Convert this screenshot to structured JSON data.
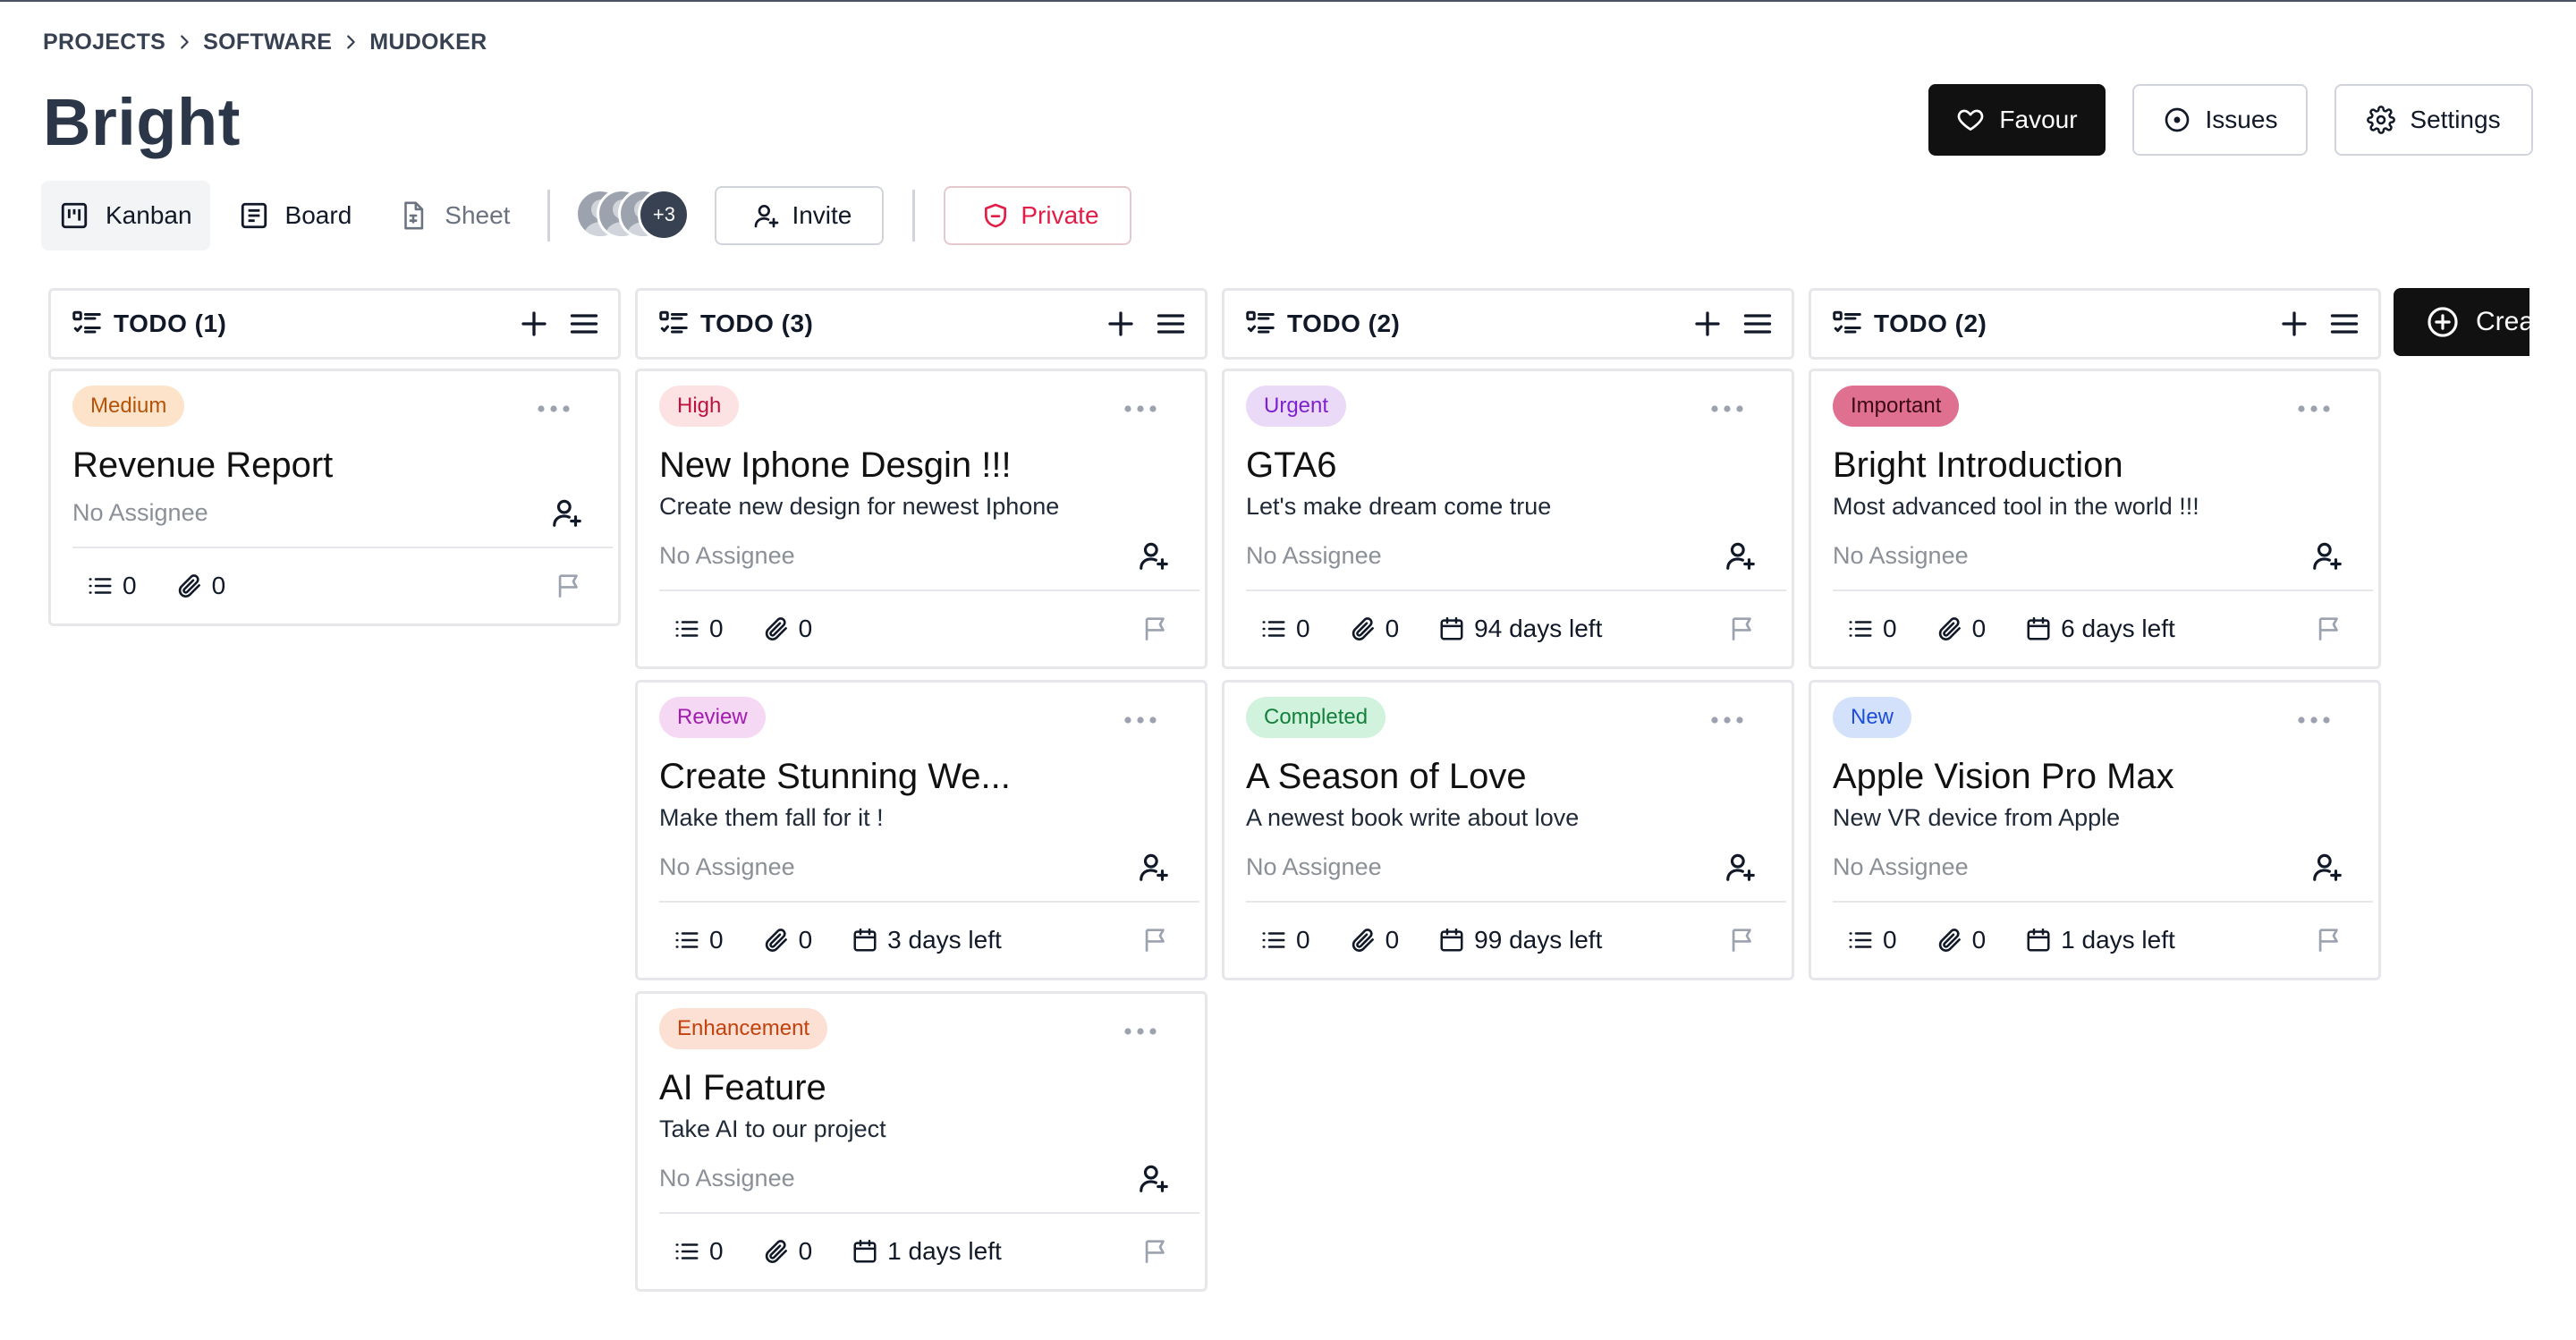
{
  "breadcrumb": [
    "PROJECTS",
    "SOFTWARE",
    "MUDOKER"
  ],
  "title": "Bright",
  "header_buttons": {
    "favour": "Favour",
    "issues": "Issues",
    "settings": "Settings"
  },
  "views": {
    "kanban": "Kanban",
    "board": "Board",
    "sheet": "Sheet"
  },
  "members": {
    "more_count": "+3"
  },
  "invite_label": "Invite",
  "private_label": "Private",
  "create_label": "Create",
  "columns": [
    {
      "title": "TODO (1)",
      "cards": [
        {
          "badge": "Medium",
          "badge_bg": "#fde3c9",
          "badge_fg": "#b45309",
          "title": "Revenue Report",
          "desc": "",
          "assignee": "No Assignee",
          "subtasks": "0",
          "attachments": "0",
          "due": ""
        }
      ]
    },
    {
      "title": "TODO (3)",
      "cards": [
        {
          "badge": "High",
          "badge_bg": "#fde2e4",
          "badge_fg": "#be123c",
          "title": "New Iphone Desgin !!!",
          "desc": "Create new design for newest Iphone",
          "assignee": "No Assignee",
          "subtasks": "0",
          "attachments": "0",
          "due": ""
        },
        {
          "badge": "Review",
          "badge_bg": "#f5d8f3",
          "badge_fg": "#a21caf",
          "title": "Create Stunning We...",
          "desc": "Make them fall for it !",
          "assignee": "No Assignee",
          "subtasks": "0",
          "attachments": "0",
          "due": "3 days left"
        },
        {
          "badge": "Enhancement",
          "badge_bg": "#fde0d4",
          "badge_fg": "#c2410c",
          "title": "AI Feature",
          "desc": "Take AI to our project",
          "assignee": "No Assignee",
          "subtasks": "0",
          "attachments": "0",
          "due": "1 days left"
        }
      ]
    },
    {
      "title": "TODO (2)",
      "cards": [
        {
          "badge": "Urgent",
          "badge_bg": "#ead9f7",
          "badge_fg": "#7e22ce",
          "title": "GTA6",
          "desc": "Let's make dream come true",
          "assignee": "No Assignee",
          "subtasks": "0",
          "attachments": "0",
          "due": "94 days left"
        },
        {
          "badge": "Completed",
          "badge_bg": "#d1f2dc",
          "badge_fg": "#15803d",
          "title": "A Season of Love",
          "desc": "A newest book write about love",
          "assignee": "No Assignee",
          "subtasks": "0",
          "attachments": "0",
          "due": "99 days left"
        }
      ]
    },
    {
      "title": "TODO (2)",
      "cards": [
        {
          "badge": "Important",
          "badge_bg": "#e0708f",
          "badge_fg": "#3b0a16",
          "title": "Bright Introduction",
          "desc": "Most advanced tool in the world !!!",
          "assignee": "No Assignee",
          "subtasks": "0",
          "attachments": "0",
          "due": "6 days left"
        },
        {
          "badge": "New",
          "badge_bg": "#d4e1fb",
          "badge_fg": "#1d4ed8",
          "title": "Apple Vision Pro Max",
          "desc": "New VR device from Apple",
          "assignee": "No Assignee",
          "subtasks": "0",
          "attachments": "0",
          "due": "1 days left"
        }
      ]
    }
  ]
}
